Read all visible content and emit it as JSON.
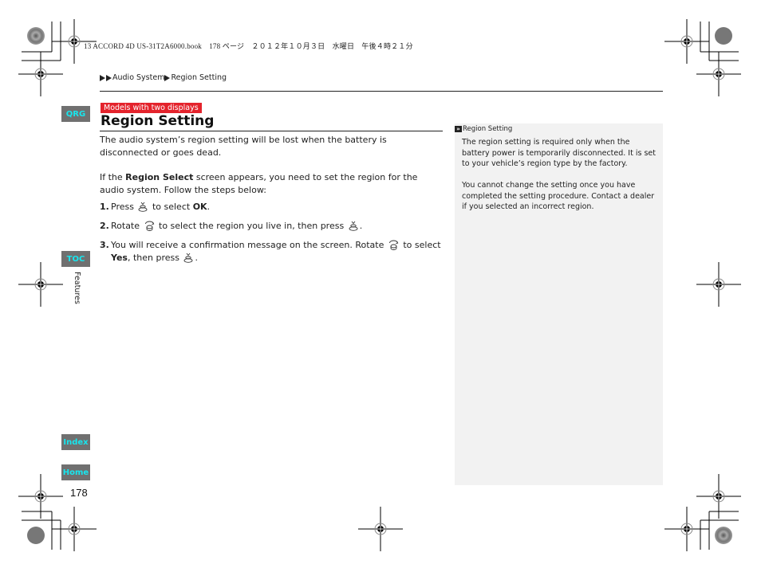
{
  "slug": {
    "text": "13 ACCORD 4D US-31T2A6000.book　178 ページ　２０１２年１０月３日　水曜日　午後４時２１分"
  },
  "breadcrumb": {
    "items": [
      "Audio System",
      "Region Setting"
    ]
  },
  "side_nav": {
    "tabs": [
      {
        "label": "QRG"
      },
      {
        "label": "TOC"
      },
      {
        "label": "Index"
      },
      {
        "label": "Home"
      }
    ],
    "section_label": "Features",
    "tab_bg_color": "#707070",
    "tab_text_color": "#18e6ee"
  },
  "page_number": "178",
  "main": {
    "model_badge": "Models with two displays",
    "model_badge_color": "#e4232c",
    "title": "Region Setting",
    "paragraphs": [
      "The audio system’s region setting will be lost when the battery is disconnected or goes dead.",
      {
        "before": "If the ",
        "bold": "Region Select",
        "after": " screen appears, you need to set the region for the audio system. Follow the steps below:"
      }
    ],
    "steps": [
      {
        "num": "1.",
        "parts": [
          "Press",
          "to select",
          "OK",
          "."
        ],
        "icons": [
          "press-knob-icon"
        ]
      },
      {
        "num": "2.",
        "parts": [
          "Rotate",
          "to select the region you live in, then press",
          "."
        ],
        "icons": [
          "rotate-knob-icon",
          "press-knob-icon"
        ]
      },
      {
        "num": "3.",
        "parts": [
          "You will receive a confirmation message on the screen. Rotate",
          "to select",
          "Yes",
          ",",
          "then press",
          "."
        ],
        "icons": [
          "rotate-knob-icon",
          "press-knob-icon"
        ]
      }
    ]
  },
  "note": {
    "heading": "Region Setting",
    "heading_icon": "double-chevron-icon",
    "paragraphs": [
      "The region setting is required only when the battery power is temporarily disconnected. It is set to your vehicle’s region type by the factory.",
      "You cannot change the setting once you have completed the setting procedure. Contact a dealer if you selected an incorrect region."
    ],
    "bg_color": "#f2f2f2"
  }
}
